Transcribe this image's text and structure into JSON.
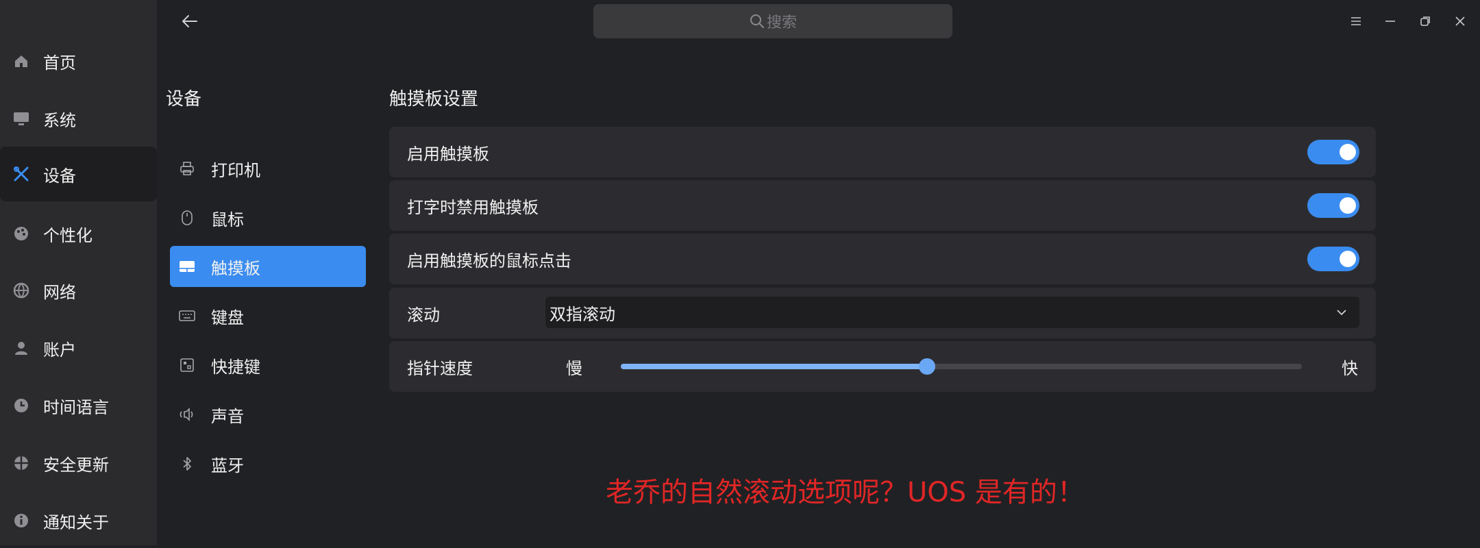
{
  "search": {
    "placeholder": "搜索"
  },
  "sidebar": {
    "items": [
      {
        "label": "首页",
        "icon": "home-icon"
      },
      {
        "label": "系统",
        "icon": "monitor-icon"
      },
      {
        "label": "设备",
        "icon": "tools-icon",
        "active": true
      },
      {
        "label": "个性化",
        "icon": "palette-icon"
      },
      {
        "label": "网络",
        "icon": "globe-icon"
      },
      {
        "label": "账户",
        "icon": "user-icon"
      },
      {
        "label": "时间语言",
        "icon": "clock-icon"
      },
      {
        "label": "安全更新",
        "icon": "shield-globe-icon"
      },
      {
        "label": "通知关于",
        "icon": "info-icon"
      }
    ]
  },
  "devices": {
    "title": "设备",
    "items": [
      {
        "label": "打印机",
        "icon": "printer-icon"
      },
      {
        "label": "鼠标",
        "icon": "mouse-icon"
      },
      {
        "label": "触摸板",
        "icon": "touchpad-icon",
        "active": true
      },
      {
        "label": "键盘",
        "icon": "keyboard-icon"
      },
      {
        "label": "快捷键",
        "icon": "shortcut-icon"
      },
      {
        "label": "声音",
        "icon": "speaker-icon"
      },
      {
        "label": "蓝牙",
        "icon": "bluetooth-icon"
      }
    ]
  },
  "touchpad": {
    "title": "触摸板设置",
    "enable_label": "启用触摸板",
    "enable_on": true,
    "disable_typing_label": "打字时禁用触摸板",
    "disable_typing_on": true,
    "tap_click_label": "启用触摸板的鼠标点击",
    "tap_click_on": true,
    "scroll_label": "滚动",
    "scroll_value": "双指滚动",
    "speed_label": "指针速度",
    "speed_min_label": "慢",
    "speed_max_label": "快",
    "speed_value": 0.45
  },
  "annotation": {
    "text": "老乔的自然滚动选项呢？UOS 是有的！"
  },
  "colors": {
    "accent": "#3a8cf0",
    "annotation": "#e02626",
    "background": "#202124"
  }
}
